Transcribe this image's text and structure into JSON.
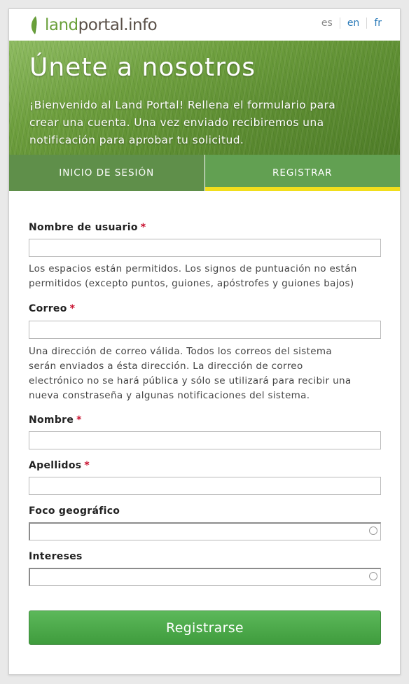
{
  "brand": {
    "logo_land": "land",
    "logo_portal": "portal.info",
    "leaf_icon": "leaf-icon",
    "leaf_color": "#6aa03a"
  },
  "languages": [
    {
      "code": "es",
      "active": true
    },
    {
      "code": "en",
      "active": false
    },
    {
      "code": "fr",
      "active": false
    }
  ],
  "hero": {
    "title": "Únete a nosotros",
    "line1": "¡Bienvenido al Land Portal! Rellena el formulario para",
    "line2": "crear una cuenta. Una vez enviado recibiremos una",
    "line3": "notificación para aprobar tu solicitud."
  },
  "tabs": {
    "login": "INICIO DE SESIÓN",
    "register": "REGISTRAR",
    "active": "register",
    "active_color": "#f1de1c"
  },
  "form": {
    "username": {
      "label": "Nombre de usuario",
      "required": "*",
      "value": "",
      "help_line1": "Los espacios están permitidos. Los signos de puntuación no están",
      "help_line2": "permitidos (excepto puntos, guiones, apóstrofes y guiones bajos)"
    },
    "email": {
      "label": "Correo",
      "required": "*",
      "value": "",
      "help_line1": "Una dirección de correo válida. Todos los correos del sistema",
      "help_line2": "serán enviados a ésta dirección. La dirección de correo",
      "help_line3": "electrónico no se hará pública y sólo se utilizará para recibir una",
      "help_line4": "nueva constraseña y algunas notificaciones del sistema."
    },
    "first_name": {
      "label": "Nombre",
      "required": "*",
      "value": ""
    },
    "last_name": {
      "label": "Apellidos",
      "required": "*",
      "value": ""
    },
    "geo_focus": {
      "label": "Foco geográfico",
      "value": ""
    },
    "interests": {
      "label": "Intereses",
      "value": ""
    },
    "submit_label": "Registrarse",
    "required_color": "#c8102e",
    "submit_color": "#4aa648"
  }
}
